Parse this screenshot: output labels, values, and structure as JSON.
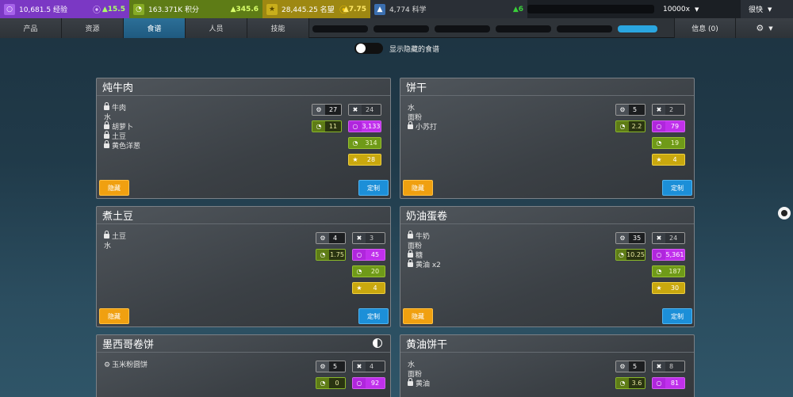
{
  "topbar": {
    "experience": {
      "value": "10,681.5 经验",
      "rate": "15.5"
    },
    "points": {
      "value": "163.371K 积分",
      "rate": "345.6"
    },
    "reputation": {
      "value": "28,445.25 名望",
      "rate": "7.75"
    },
    "science": {
      "value": "4,774 科学",
      "rate": "6"
    },
    "multiplier": "10000x",
    "speed": "很快"
  },
  "nav": {
    "tabs": [
      "产品",
      "资源",
      "食谱",
      "人员",
      "技能"
    ],
    "active": "食谱",
    "info_label": "信息 (0)"
  },
  "toggle": {
    "label": "显示隐藏的食谱",
    "on": false
  },
  "buttons": {
    "hide": "隐藏",
    "custom": "定制"
  },
  "recipes": [
    {
      "name": "炖牛肉",
      "ingredients": [
        {
          "text": "牛肉",
          "icon": "lock-icon"
        },
        {
          "text": "水",
          "icon": ""
        },
        {
          "text": "胡萝卜",
          "icon": "lock-icon"
        },
        {
          "text": "土豆",
          "icon": "lock-icon"
        },
        {
          "text": "黄色洋葱",
          "icon": "lock-icon"
        }
      ],
      "gears": "27",
      "forks": "24",
      "time": "11",
      "experience": "3,133",
      "points": "314",
      "reputation": "28"
    },
    {
      "name": "饼干",
      "ingredients": [
        {
          "text": "水",
          "icon": ""
        },
        {
          "text": "面粉",
          "icon": ""
        },
        {
          "text": "小苏打",
          "icon": "lock-icon"
        }
      ],
      "gears": "5",
      "forks": "2",
      "time": "2.2",
      "experience": "79",
      "points": "19",
      "reputation": "4"
    },
    {
      "name": "煮土豆",
      "ingredients": [
        {
          "text": "土豆",
          "icon": "lock-icon"
        },
        {
          "text": "水",
          "icon": ""
        }
      ],
      "gears": "4",
      "forks": "3",
      "time": "1.75",
      "experience": "45",
      "points": "20",
      "reputation": "4"
    },
    {
      "name": "奶油蛋卷",
      "ingredients": [
        {
          "text": "牛奶",
          "icon": "lock-icon"
        },
        {
          "text": "面粉",
          "icon": ""
        },
        {
          "text": "糖",
          "icon": "lock-icon"
        },
        {
          "text": "黄油 x2",
          "icon": "lock-icon"
        }
      ],
      "gears": "35",
      "forks": "24",
      "time": "10.25",
      "experience": "5,361",
      "points": "187",
      "reputation": "30"
    },
    {
      "name": "墨西哥卷饼",
      "ingredients": [
        {
          "text": "玉米粉圆饼",
          "icon": "gear-icon"
        }
      ],
      "gears": "5",
      "forks": "4",
      "time": "0",
      "experience": "92"
    },
    {
      "name": "黄油饼干",
      "ingredients": [
        {
          "text": "水",
          "icon": ""
        },
        {
          "text": "面粉",
          "icon": ""
        },
        {
          "text": "黄油",
          "icon": "lock-icon"
        }
      ],
      "gears": "5",
      "forks": "8",
      "time": "3.6",
      "experience": "81"
    }
  ]
}
